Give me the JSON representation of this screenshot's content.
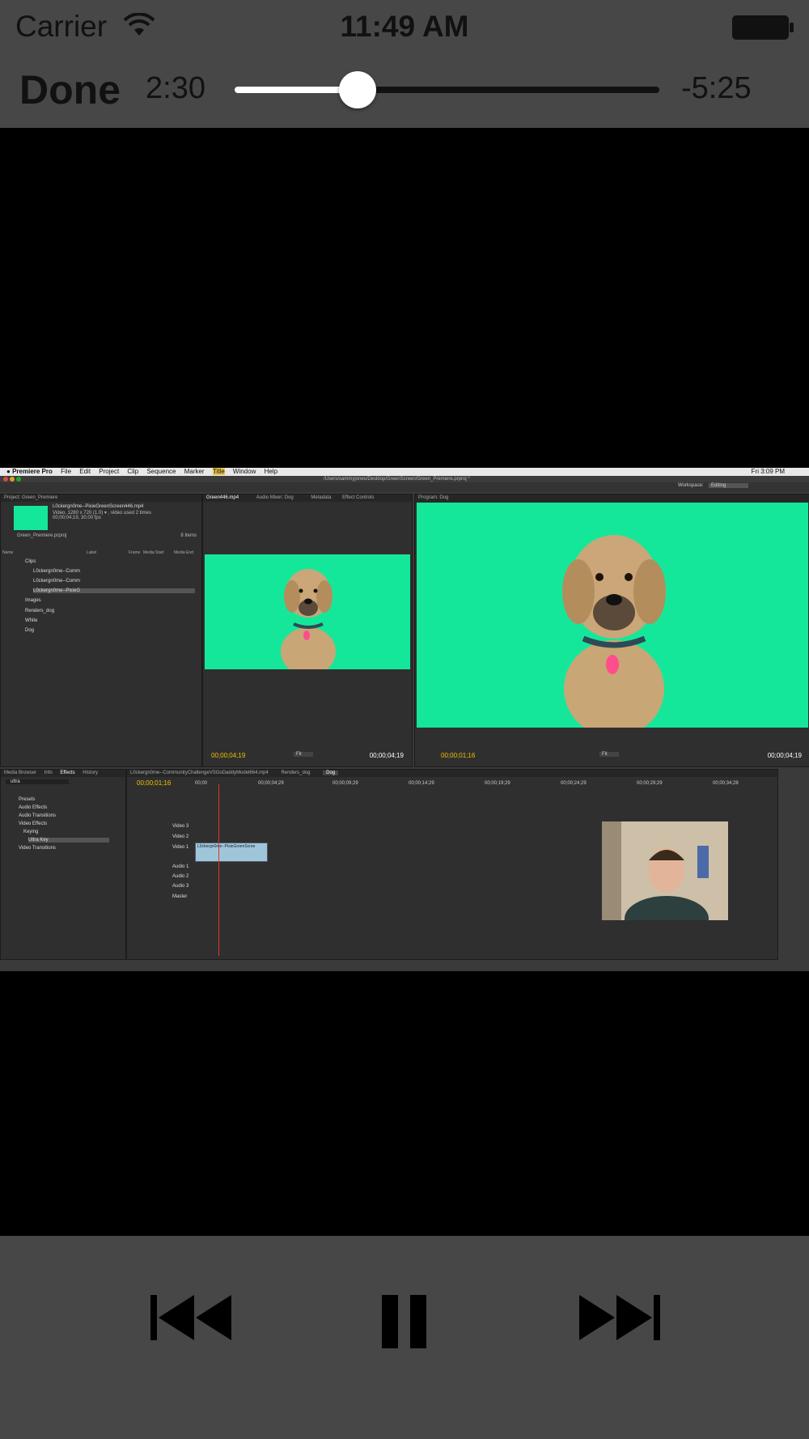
{
  "status_bar": {
    "carrier": "Carrier",
    "time": "11:49 AM"
  },
  "player": {
    "done_label": "Done",
    "elapsed": "2:30",
    "remaining": "-5:25",
    "progress_fraction": 0.29
  },
  "video_frame": {
    "app_menu": {
      "app": "Premiere Pro",
      "items": [
        "File",
        "Edit",
        "Project",
        "Clip",
        "Sequence",
        "Marker",
        "Title",
        "Window",
        "Help"
      ],
      "clock": "Fri 3:09 PM"
    },
    "file_path": "/Users/sammyjones/Desktop/GreenScreen/Green_Premiere.prproj *",
    "project_panel": {
      "tab": "Project: Green_Premiere",
      "clip_name": "L0ckergn0me--PixieGreenScreen446.mp4",
      "clip_info": "Video, 1280 x 720 (1.0) ▾ , video used 2 times",
      "clip_duration": "00;00;04;19, 30.00 fps",
      "project_file": "Green_Premiere.prproj",
      "item_count": "8 Items",
      "columns": [
        "Name",
        "Label",
        "Frame",
        "Media Start",
        "Media End"
      ],
      "rows": [
        "Clips",
        "L0ckergn0me--Comm",
        "L0ckergn0me--Comm",
        "L0ckergn0me--PixieG",
        "Images",
        "Renders_dog",
        "White",
        "Dog"
      ]
    },
    "source_panel": {
      "tabs": [
        "Green446.mp4",
        "Audio Mixer: Dog",
        "Metadata",
        "Effect Controls"
      ],
      "tc_left": "00;00;04;19",
      "tc_right": "00;00;04;19",
      "fit": "Fit"
    },
    "program_panel": {
      "tab": "Program: Dog",
      "tc_left": "00;00;01;16",
      "tc_right": "00;00;04;19",
      "fit": "Fit",
      "workspace_label": "Workspace:",
      "workspace_value": "Editing"
    },
    "effects_panel": {
      "tabs": [
        "Media Browser",
        "Info",
        "Effects",
        "History"
      ],
      "search": "ultra",
      "tree": [
        "Presets",
        "Audio Effects",
        "Audio Transitions",
        "Video Effects",
        "Keying",
        "Ultra Key",
        "Video Transitions"
      ]
    },
    "timeline": {
      "tabs": [
        "L0ckergn0me--CommunityChallengeVSGoDaddyModel664.mp4",
        "Renders_dog",
        "Dog"
      ],
      "timecode": "00;00;01;16",
      "ruler": [
        "00;00",
        "00;00;04;29",
        "00;00;09;29",
        "00;00;14;29",
        "00;00;19;29",
        "00;00;24;29",
        "00;00;29;29",
        "00;00;34;28"
      ],
      "tracks": [
        "Video 3",
        "Video 2",
        "Video 1",
        "Audio 1",
        "Audio 2",
        "Audio 3",
        "Master"
      ],
      "clip_label": "L0ckergn0me--PixieGreenScree"
    }
  },
  "controls": {
    "previous": "skip-back-icon",
    "pause": "pause-icon",
    "next": "skip-forward-icon"
  },
  "colors": {
    "bar": "#474747",
    "screen_green": "#15e79a",
    "timecode": "#f2c200"
  }
}
